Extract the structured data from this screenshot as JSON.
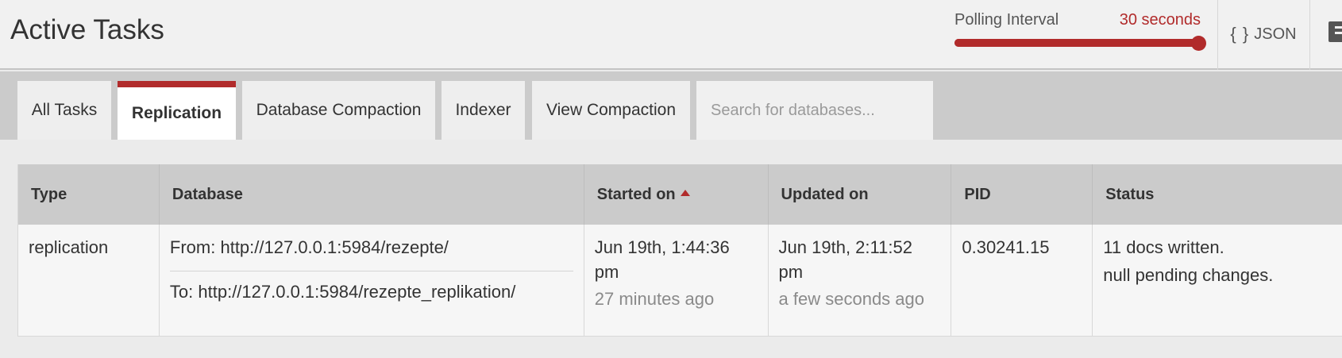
{
  "header": {
    "title": "Active Tasks",
    "polling": {
      "label": "Polling Interval",
      "value_text": "30 seconds",
      "slider_fraction": 1.0
    },
    "json_button": {
      "icon": "braces-icon",
      "glyph": "{ }",
      "label": "JSON"
    },
    "docs_icon": "book-icon"
  },
  "tabs": [
    {
      "label": "All Tasks",
      "active": false
    },
    {
      "label": "Replication",
      "active": true
    },
    {
      "label": "Database Compaction",
      "active": false
    },
    {
      "label": "Indexer",
      "active": false
    },
    {
      "label": "View Compaction",
      "active": false
    }
  ],
  "search": {
    "placeholder": "Search for databases...",
    "value": ""
  },
  "table": {
    "headers": [
      "Type",
      "Database",
      "Started on",
      "Updated on",
      "PID",
      "Status"
    ],
    "sorted_column": "Started on",
    "sort_direction": "ascending",
    "rows": [
      {
        "type": "replication",
        "database_from": "From: http://127.0.0.1:5984/rezepte/",
        "database_to": "To: http://127.0.0.1:5984/rezepte_replikation/",
        "started_on": "Jun 19th, 1:44:36 pm",
        "started_ago": "27 minutes ago",
        "updated_on": "Jun 19th, 2:11:52 pm",
        "updated_ago": "a few seconds ago",
        "pid": "0.30241.15",
        "status_1": "11 docs written.",
        "status_2": "null pending changes."
      }
    ]
  },
  "colors": {
    "accent": "#b12b2b",
    "header_bg": "#f1f1f1",
    "tabbar_bg": "#cbcbcb"
  }
}
